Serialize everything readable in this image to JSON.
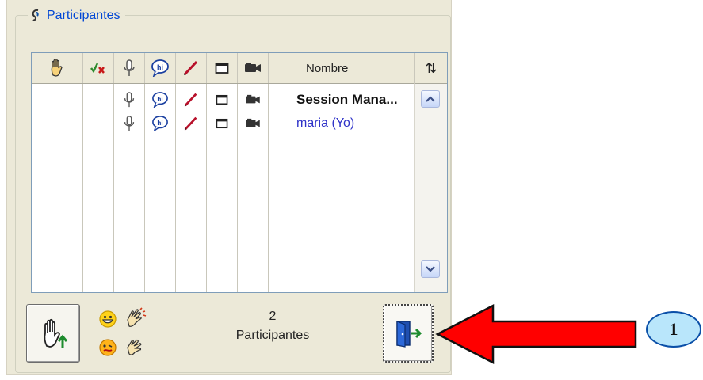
{
  "panel": {
    "title": "Participantes",
    "title_icon": "ear-icon"
  },
  "grid": {
    "columns": [
      {
        "name": "raise-hand",
        "icon": "raised-hand-icon"
      },
      {
        "name": "approve",
        "icon": "check-x-icon"
      },
      {
        "name": "microphone",
        "icon": "microphone-icon"
      },
      {
        "name": "chat",
        "icon": "chat-bubble-icon"
      },
      {
        "name": "whiteboard",
        "icon": "pen-icon"
      },
      {
        "name": "screen",
        "icon": "window-icon"
      },
      {
        "name": "video",
        "icon": "camera-icon"
      }
    ],
    "name_header": "Nombre",
    "sort_icon": "sort-arrows-icon",
    "sort_glyph": "⇅",
    "rows": [
      {
        "name": "Session Mana...",
        "style": "bold"
      },
      {
        "name": "maria (Yo)",
        "style": "self"
      }
    ]
  },
  "footer": {
    "count": "2",
    "count_label": "Participantes",
    "raise_hand_button_icon": "raised-hand-up-icon",
    "emoticons": [
      "happy-face-icon",
      "applause-icon",
      "confused-face-icon",
      "clapping-hand-icon"
    ],
    "exit_button_icon": "exit-door-icon"
  },
  "callout": {
    "number": "1",
    "arrow_color": "#ff0000",
    "badge_color": "#b9e6fb"
  }
}
